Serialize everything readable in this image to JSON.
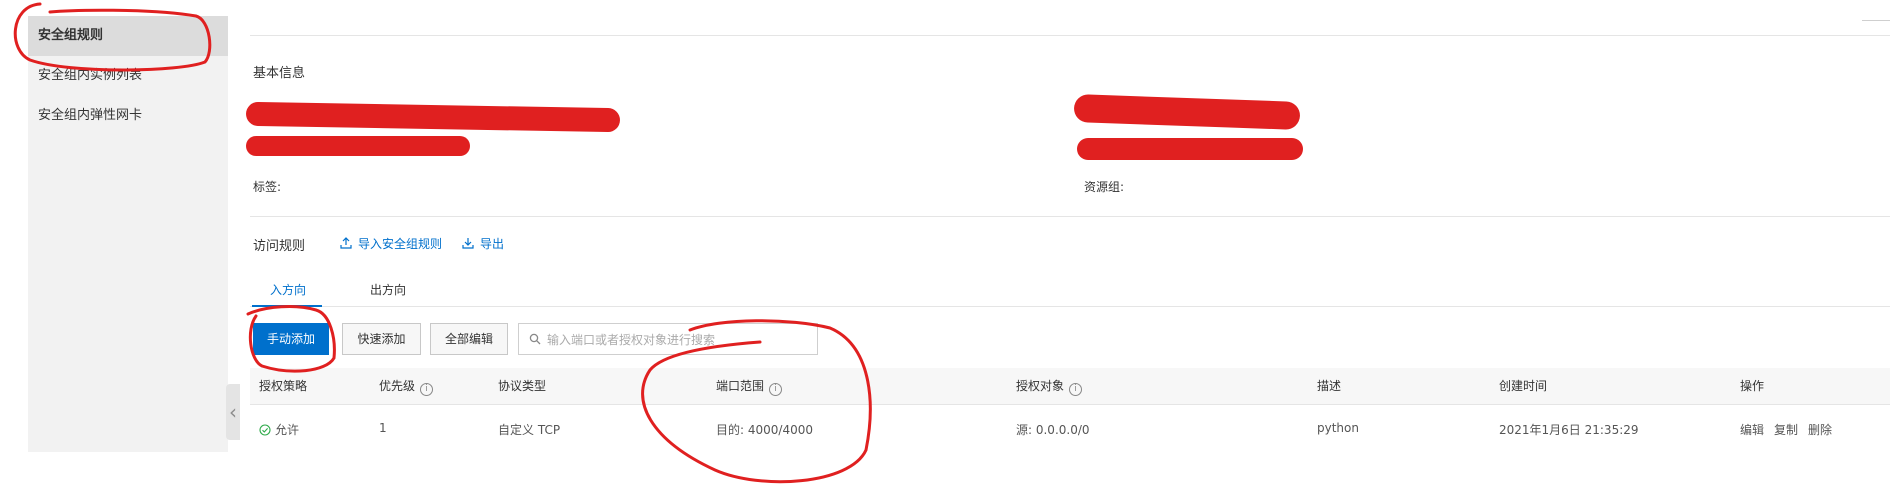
{
  "sidebar": {
    "items": [
      {
        "label": "安全组规则"
      },
      {
        "label": "安全组内实例列表"
      },
      {
        "label": "安全组内弹性网卡"
      }
    ]
  },
  "basic_info": {
    "title": "基本信息",
    "tags_label": "标签:",
    "resource_group_label": "资源组:"
  },
  "access_rules": {
    "title": "访问规则",
    "import_label": "导入安全组规则",
    "export_label": "导出"
  },
  "tabs": [
    {
      "label": "入方向",
      "active": true
    },
    {
      "label": "出方向",
      "active": false
    }
  ],
  "toolbar": {
    "manual_add": "手动添加",
    "quick_add": "快速添加",
    "edit_all": "全部编辑",
    "search_placeholder": "输入端口或者授权对象进行搜索"
  },
  "table": {
    "columns": [
      "授权策略",
      "优先级",
      "协议类型",
      "端口范围",
      "授权对象",
      "描述",
      "创建时间",
      "操作"
    ],
    "rows": [
      {
        "policy": "允许",
        "priority": "1",
        "protocol": "自定义 TCP",
        "port_range": "目的: 4000/4000",
        "auth_object": "源: 0.0.0.0/0",
        "description": "python",
        "created": "2021年1月6日 21:35:29",
        "actions": [
          "编辑",
          "复制",
          "删除"
        ]
      }
    ]
  },
  "colors": {
    "accent": "#0070cc",
    "annotation_red": "#e02020",
    "success_green": "#2eaa4a"
  }
}
